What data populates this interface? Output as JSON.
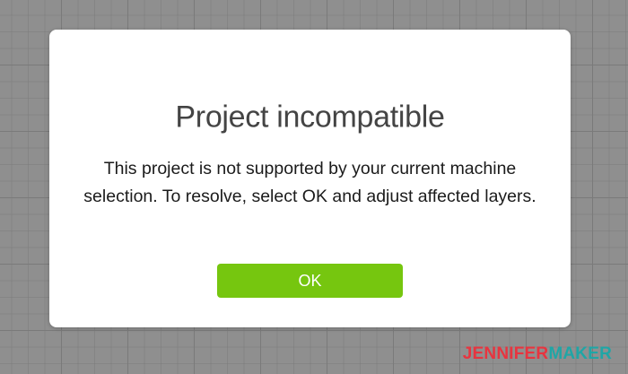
{
  "dialog": {
    "title": "Project incompatible",
    "message": "This project is not supported by your current machine selection. To resolve, select OK and adjust affected layers.",
    "ok_label": "OK"
  },
  "watermark": {
    "part1": "JENNIFER",
    "part2": "MAKER"
  },
  "colors": {
    "ok_button": "#76c60f",
    "background_grid": "#8f8f8f",
    "watermark_red": "#e8343f",
    "watermark_teal": "#1fa6a6"
  }
}
